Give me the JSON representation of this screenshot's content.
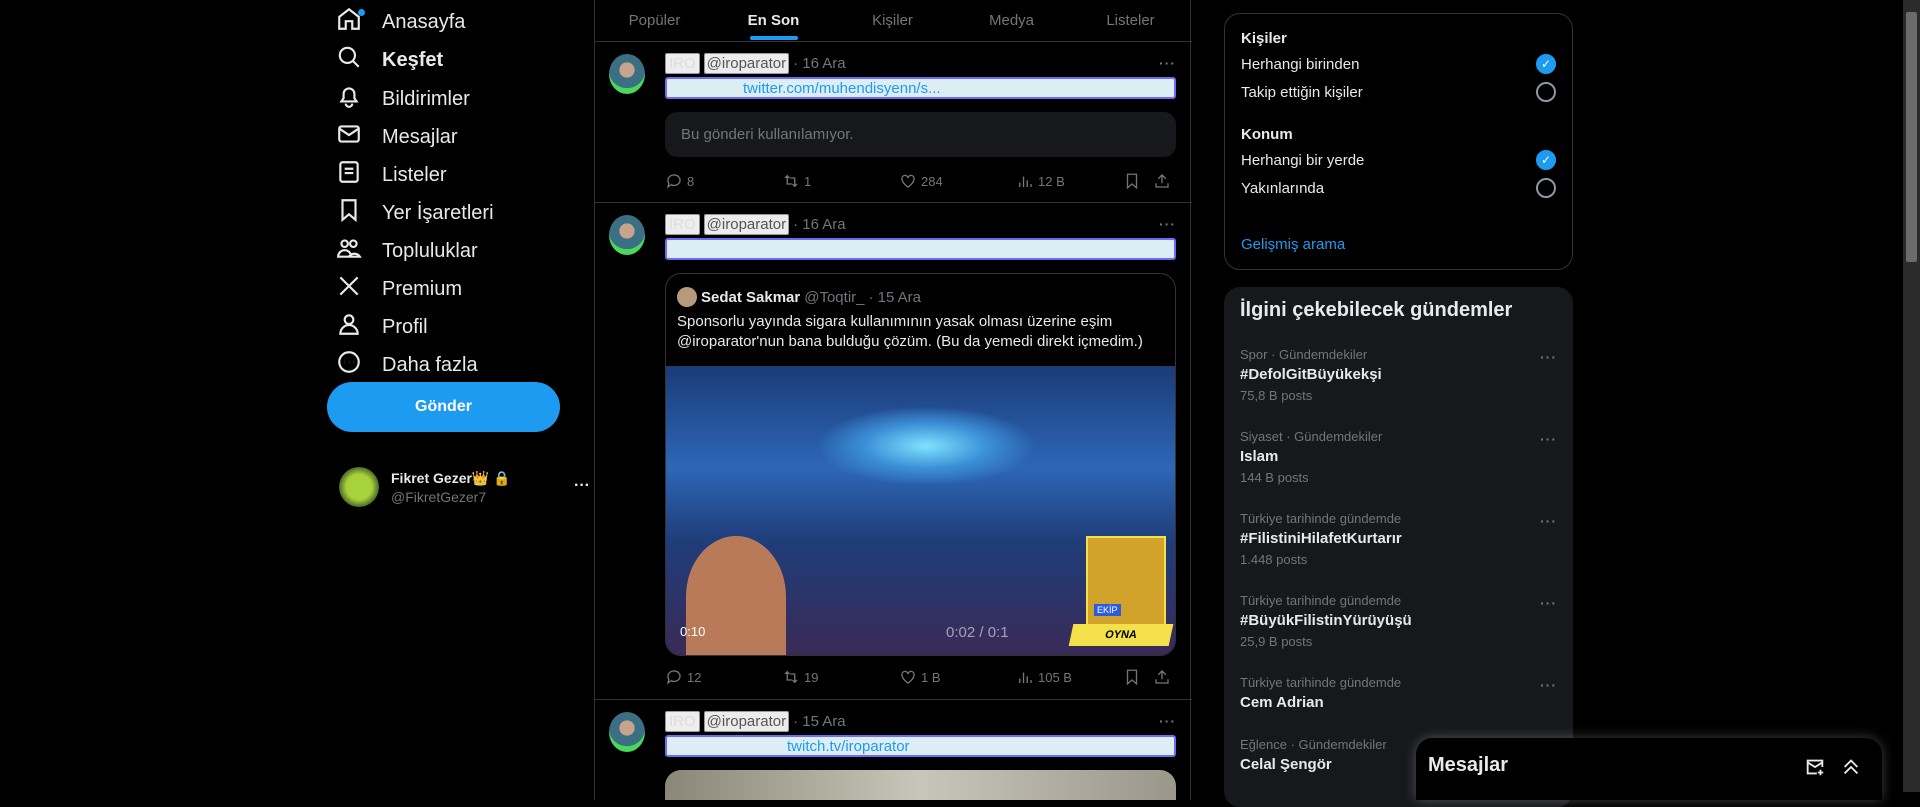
{
  "nav": [
    {
      "label": "Anasayfa",
      "icon": "home-icon"
    },
    {
      "label": "Keşfet",
      "icon": "search-icon"
    },
    {
      "label": "Bildirimler",
      "icon": "bell-icon"
    },
    {
      "label": "Mesajlar",
      "icon": "mail-icon"
    },
    {
      "label": "Listeler",
      "icon": "list-icon"
    },
    {
      "label": "Yer İşaretleri",
      "icon": "bookmark-icon"
    },
    {
      "label": "Topluluklar",
      "icon": "communities-icon"
    },
    {
      "label": "Premium",
      "icon": "x-logo-icon"
    },
    {
      "label": "Profil",
      "icon": "person-icon"
    },
    {
      "label": "Daha fazla",
      "icon": "more-circle-icon"
    }
  ],
  "send_label": "Gönder",
  "account": {
    "name": "Fikret Gezer👑",
    "handle": "@FikretGezer7"
  },
  "tabs": [
    "Popüler",
    "En Son",
    "Kişiler",
    "Medya",
    "Listeler"
  ],
  "tweets": [
    {
      "name": "IRO",
      "handle": "@iroparator",
      "date": "· 16 Ara",
      "link": "twitter.com/muhendisyenn/s...",
      "unavailable": "Bu gönderi kullanılamıyor.",
      "replies": "8",
      "retweets": "1",
      "likes": "284",
      "views": "12 B"
    },
    {
      "name": "IRO",
      "handle": "@iroparator",
      "date": "· 16 Ara",
      "quote": {
        "name": "Sedat Sakmar",
        "handle": "@Toqtir_",
        "date": "· 15 Ara",
        "text": "Sponsorlu yayında sigara kullanımının yasak olması üzerine eşim @iroparator'nun bana bulduğu çözüm. (Bu da yemedi direkt içmedim.)",
        "video_time": "0:10",
        "video_progress": "0:02 / 0:1",
        "game_button": "OYNA",
        "game_badge": "EKİP"
      },
      "replies": "12",
      "retweets": "19",
      "likes": "1 B",
      "views": "105 B"
    },
    {
      "name": "IRO",
      "handle": "@iroparator",
      "date": "· 15 Ara",
      "link": "twitch.tv/iroparator"
    }
  ],
  "filters": {
    "people_title": "Kişiler",
    "people_opts": [
      "Herhangi birinden",
      "Takip ettiğin kişiler"
    ],
    "location_title": "Konum",
    "location_opts": [
      "Herhangi bir yerde",
      "Yakınlarında"
    ],
    "advanced": "Gelişmiş arama"
  },
  "trends_title": "İlgini çekebilecek gündemler",
  "trends": [
    {
      "cat": "Spor · Gündemdekiler",
      "name": "#DefolGitBüyükekşi",
      "count": "75,8 B posts"
    },
    {
      "cat": "Siyaset · Gündemdekiler",
      "name": "Islam",
      "count": "144 B posts"
    },
    {
      "cat": "Türkiye tarihinde gündemde",
      "name": "#FilistiniHilafetKurtarır",
      "count": "1.448 posts"
    },
    {
      "cat": "Türkiye tarihinde gündemde",
      "name": "#BüyükFilistinYürüyüşü",
      "count": "25,9 B posts"
    },
    {
      "cat": "Türkiye tarihinde gündemde",
      "name": "Cem Adrian",
      "count": ""
    },
    {
      "cat": "Eğlence · Gündemdekiler",
      "name": "Celal Şengör",
      "count": ""
    }
  ],
  "messages_title": "Mesajlar",
  "colors": {
    "accent": "#1d9bf0",
    "bg": "#000000",
    "text": "#e7e9ea",
    "muted": "#71767b"
  }
}
